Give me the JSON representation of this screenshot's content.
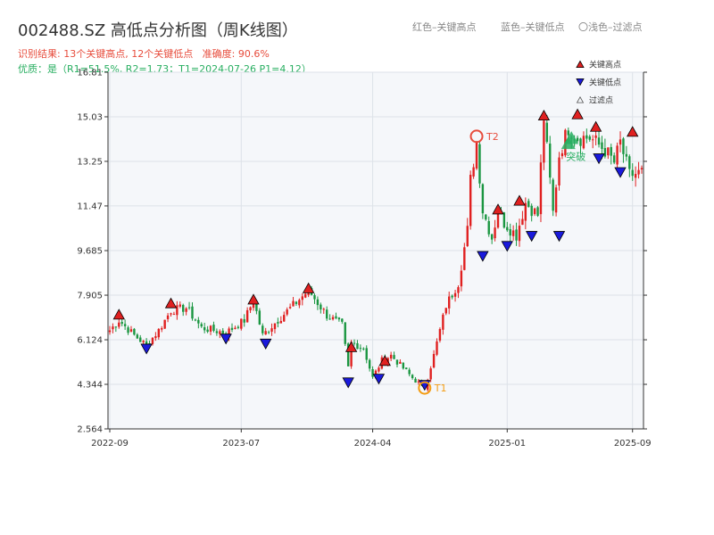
{
  "header": {
    "title": "002488.SZ 高低点分析图（周K线图）",
    "result_line": "识别结果: 13个关键高点, 12个关键低点   准确度: 90.6%",
    "quality_line": "优质：是（R1=51.5%, R2=1.73；T1=2024-07-26 P1=4.12）",
    "legend_red": "红色–关键高点",
    "legend_blue": "蓝色–关键低点",
    "legend_light": "〇浅色–过滤点"
  },
  "colors": {
    "up": "#e02020",
    "down": "#1a9641",
    "high_marker": "#e02020",
    "low_marker": "#1a1adc",
    "t1": "#f39c12",
    "t2": "#e74c3c",
    "plot_bg": "#f5f7fa",
    "grid": "#dde2e8"
  },
  "chart_data": {
    "type": "candlestick",
    "yticks": [
      "2.564",
      "4.344",
      "6.124",
      "7.905",
      "9.685",
      "11.47",
      "13.25",
      "15.03",
      "16.81"
    ],
    "ylim": [
      2.564,
      16.81
    ],
    "xticks": [
      {
        "label": "2022-09",
        "index": 0
      },
      {
        "label": "2023-07",
        "index": 43
      },
      {
        "label": "2024-04",
        "index": 86
      },
      {
        "label": "2025-01",
        "index": 130
      },
      {
        "label": "2025-09",
        "index": 171
      }
    ],
    "x_count": 175,
    "legend": [
      {
        "name": "关键高点",
        "shape": "triangle-up",
        "color": "#e02020"
      },
      {
        "name": "关键低点",
        "shape": "triangle-down",
        "color": "#1a1adc"
      },
      {
        "name": "过滤点",
        "shape": "triangle-up-outline",
        "color": "#888888"
      }
    ],
    "anchors": [
      [
        0,
        6.5
      ],
      [
        3,
        6.9
      ],
      [
        8,
        6.3
      ],
      [
        12,
        5.9
      ],
      [
        16,
        6.5
      ],
      [
        20,
        7.3
      ],
      [
        25,
        7.4
      ],
      [
        30,
        6.6
      ],
      [
        38,
        6.4
      ],
      [
        44,
        6.9
      ],
      [
        47,
        7.7
      ],
      [
        50,
        6.3
      ],
      [
        54,
        6.8
      ],
      [
        60,
        7.5
      ],
      [
        65,
        8.1
      ],
      [
        71,
        7.1
      ],
      [
        76,
        6.7
      ],
      [
        78,
        5.0
      ],
      [
        79,
        6.0
      ],
      [
        83,
        5.8
      ],
      [
        86,
        4.6
      ],
      [
        89,
        5.3
      ],
      [
        92,
        5.5
      ],
      [
        99,
        4.6
      ],
      [
        103,
        4.2
      ],
      [
        106,
        5.5
      ],
      [
        110,
        7.5
      ],
      [
        114,
        8.4
      ],
      [
        117,
        10.5
      ],
      [
        118,
        12.5
      ],
      [
        120,
        14.0
      ],
      [
        122,
        11.3
      ],
      [
        125,
        10.2
      ],
      [
        127,
        11.3
      ],
      [
        129,
        10.8
      ],
      [
        133,
        10.3
      ],
      [
        136,
        11.6
      ],
      [
        140,
        11.1
      ],
      [
        142,
        15.0
      ],
      [
        145,
        11.2
      ],
      [
        147,
        13.5
      ],
      [
        150,
        14.6
      ],
      [
        153,
        14.2
      ],
      [
        157,
        14.2
      ],
      [
        162,
        13.7
      ],
      [
        165,
        13.2
      ],
      [
        167,
        14.0
      ],
      [
        170,
        12.7
      ],
      [
        174,
        12.8
      ]
    ],
    "key_highs": [
      {
        "i": 3,
        "price": 7.0
      },
      {
        "i": 20,
        "price": 7.45
      },
      {
        "i": 47,
        "price": 7.6
      },
      {
        "i": 65,
        "price": 8.05
      },
      {
        "i": 79,
        "price": 5.7
      },
      {
        "i": 90,
        "price": 5.15
      },
      {
        "i": 127,
        "price": 11.2
      },
      {
        "i": 134,
        "price": 11.55
      },
      {
        "i": 142,
        "price": 14.95
      },
      {
        "i": 153,
        "price": 15.0
      },
      {
        "i": 159,
        "price": 14.5
      },
      {
        "i": 171,
        "price": 14.3
      }
    ],
    "key_lows": [
      {
        "i": 12,
        "price": 5.9
      },
      {
        "i": 38,
        "price": 6.3
      },
      {
        "i": 51,
        "price": 6.1
      },
      {
        "i": 78,
        "price": 4.55
      },
      {
        "i": 88,
        "price": 4.7
      },
      {
        "i": 103,
        "price": 4.45
      },
      {
        "i": 122,
        "price": 9.6
      },
      {
        "i": 130,
        "price": 10.0
      },
      {
        "i": 138,
        "price": 10.4
      },
      {
        "i": 147,
        "price": 10.4
      },
      {
        "i": 160,
        "price": 13.5
      },
      {
        "i": 167,
        "price": 12.95
      }
    ],
    "filtered_points": [
      {
        "i": 150,
        "price": 14.0
      },
      {
        "i": 151,
        "price": 14.2
      }
    ],
    "t1": {
      "label": "T1",
      "i": 103,
      "price": 4.2
    },
    "t2": {
      "label": "T2",
      "i": 120,
      "price": 14.25
    },
    "breakout_label": "突破"
  }
}
